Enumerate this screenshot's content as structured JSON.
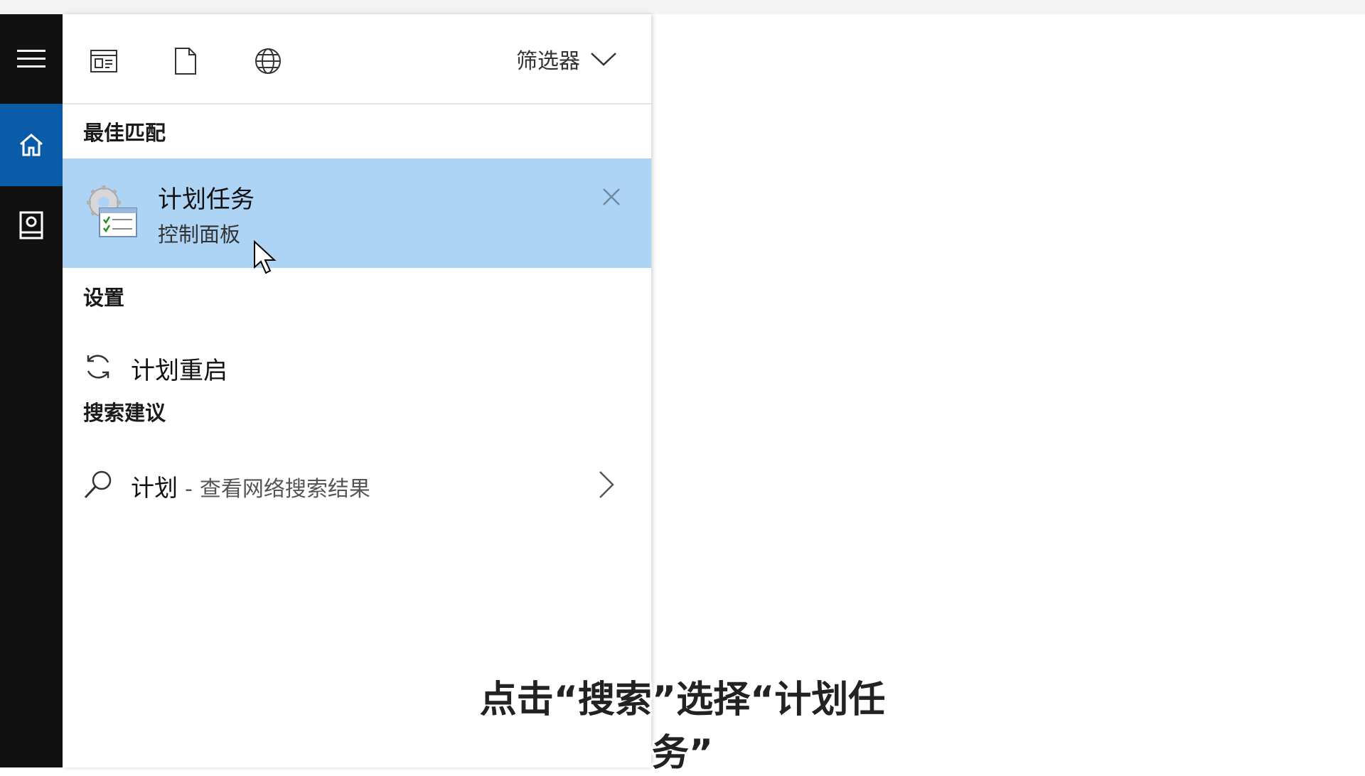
{
  "rail": {
    "icons": [
      "hamburger-menu-icon",
      "home-icon",
      "notebook-icon"
    ],
    "active": "home",
    "active_color": "#0a5ca8"
  },
  "toolbar": {
    "icons": [
      "apps-icon",
      "documents-icon",
      "web-globe-icon"
    ],
    "filter_label": "筛选器"
  },
  "best_match": {
    "heading": "最佳匹配",
    "title": "计划任务",
    "subtitle": "控制面板",
    "highlight_color": "#aed4f5"
  },
  "settings": {
    "heading": "设置",
    "item_label": "计划重启"
  },
  "suggestions": {
    "heading": "搜索建议",
    "term": "计划",
    "separator": "-",
    "hint": "查看网络搜索结果"
  },
  "caption": "点击“搜索”选择“计划任务”"
}
